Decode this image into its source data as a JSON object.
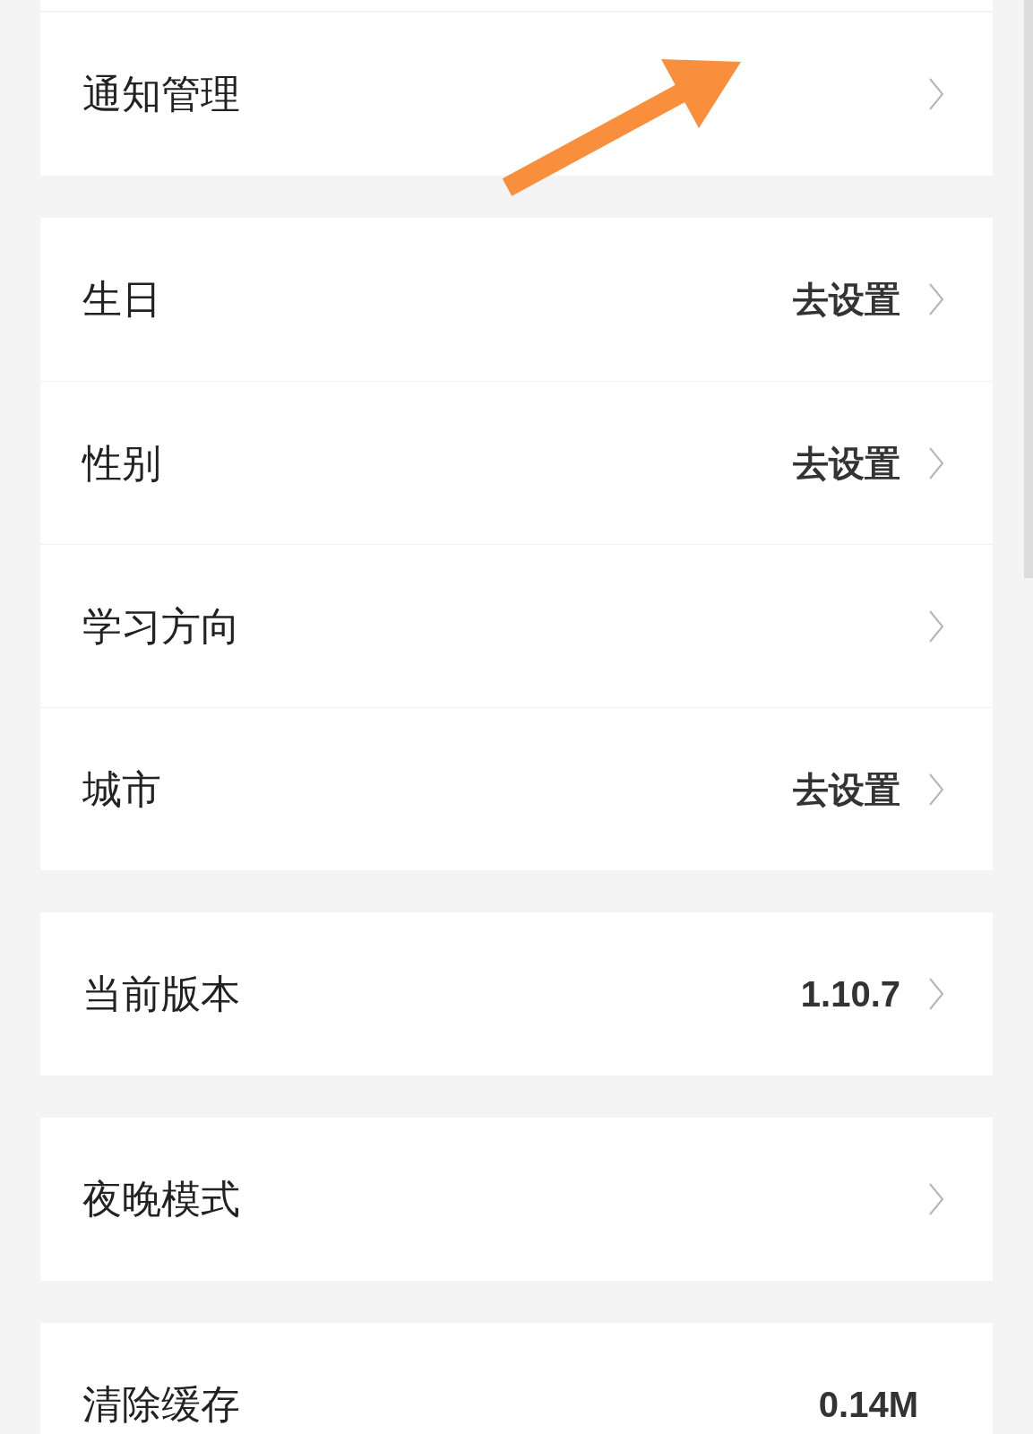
{
  "sections": [
    {
      "rows": [
        {
          "label": "通知管理",
          "chevron": true
        }
      ]
    },
    {
      "rows": [
        {
          "label": "生日",
          "value": "去设置",
          "chevron": true
        },
        {
          "label": "性别",
          "value": "去设置",
          "chevron": true
        },
        {
          "label": "学习方向",
          "chevron": true
        },
        {
          "label": "城市",
          "value": "去设置",
          "chevron": true
        }
      ]
    },
    {
      "rows": [
        {
          "label": "当前版本",
          "value": "1.10.7",
          "chevron": true
        }
      ]
    },
    {
      "rows": [
        {
          "label": "夜晚模式",
          "chevron": true
        }
      ]
    },
    {
      "rows": [
        {
          "label": "清除缓存",
          "value": "0.14M",
          "chevron": false
        }
      ]
    }
  ]
}
